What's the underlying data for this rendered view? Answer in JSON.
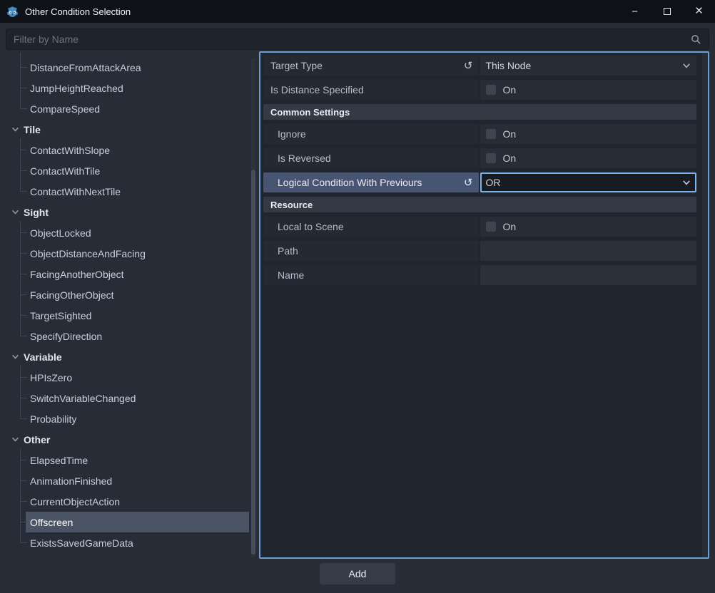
{
  "window": {
    "title": "Other Condition Selection"
  },
  "icons": {
    "minimize": "−",
    "close": "×",
    "revert": "↺"
  },
  "filter": {
    "placeholder": "Filter by Name"
  },
  "tree": {
    "orphans": [
      "DistanceFromAttackArea",
      "JumpHeightReached",
      "CompareSpeed"
    ],
    "groups": [
      {
        "label": "Tile",
        "children": [
          "ContactWithSlope",
          "ContactWithTile",
          "ContactWithNextTile"
        ]
      },
      {
        "label": "Sight",
        "children": [
          "ObjectLocked",
          "ObjectDistanceAndFacing",
          "FacingAnotherObject",
          "FacingOtherObject",
          "TargetSighted",
          "SpecifyDirection"
        ]
      },
      {
        "label": "Variable",
        "children": [
          "HPIsZero",
          "SwitchVariableChanged",
          "Probability"
        ]
      },
      {
        "label": "Other",
        "children": [
          "ElapsedTime",
          "AnimationFinished",
          "CurrentObjectAction",
          "Offscreen",
          "ExistsSavedGameData"
        ]
      }
    ],
    "selected": "Offscreen"
  },
  "inspector": {
    "target_type": {
      "label": "Target Type",
      "value": "This Node"
    },
    "is_distance": {
      "label": "Is Distance Specified",
      "on": "On"
    },
    "sections": {
      "common": "Common Settings",
      "resource": "Resource"
    },
    "ignore": {
      "label": "Ignore",
      "on": "On"
    },
    "is_reversed": {
      "label": "Is Reversed",
      "on": "On"
    },
    "logical": {
      "label": "Logical Condition With Previours",
      "value": "OR"
    },
    "local_to_scene": {
      "label": "Local to Scene",
      "on": "On"
    },
    "path": {
      "label": "Path",
      "value": ""
    },
    "name": {
      "label": "Name",
      "value": ""
    }
  },
  "footer": {
    "add_label": "Add"
  },
  "colors": {
    "accent_border": "#6b9fd4",
    "focus_border": "#7ab2ec",
    "tree_selection": "#4b5464",
    "row_highlight": "#475572",
    "titlebar": "#0e1116",
    "background": "#282c36",
    "panel": "#21252e"
  }
}
